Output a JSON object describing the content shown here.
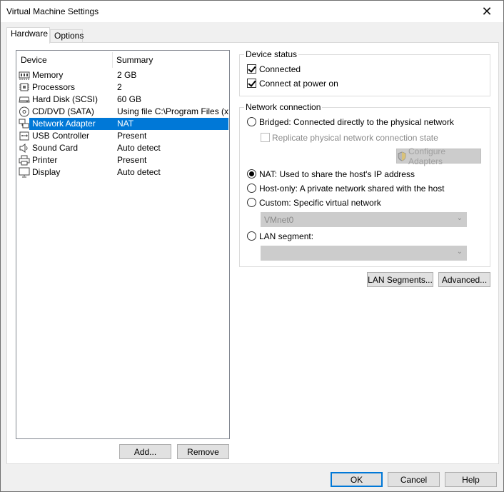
{
  "window": {
    "title": "Virtual Machine Settings",
    "close_glyph": "✕"
  },
  "tabs": [
    {
      "label": "Hardware",
      "active": true
    },
    {
      "label": "Options",
      "active": false
    }
  ],
  "device_list": {
    "headers": {
      "device": "Device",
      "summary": "Summary"
    },
    "rows": [
      {
        "icon": "memory-icon",
        "name": "Memory",
        "summary": "2 GB"
      },
      {
        "icon": "processor-icon",
        "name": "Processors",
        "summary": "2"
      },
      {
        "icon": "hard-disk-icon",
        "name": "Hard Disk (SCSI)",
        "summary": "60 GB"
      },
      {
        "icon": "cd-dvd-icon",
        "name": "CD/DVD (SATA)",
        "summary": "Using file C:\\Program Files (x..."
      },
      {
        "icon": "network-adapter-icon",
        "name": "Network Adapter",
        "summary": "NAT",
        "selected": true
      },
      {
        "icon": "usb-icon",
        "name": "USB Controller",
        "summary": "Present"
      },
      {
        "icon": "sound-card-icon",
        "name": "Sound Card",
        "summary": "Auto detect"
      },
      {
        "icon": "printer-icon",
        "name": "Printer",
        "summary": "Present"
      },
      {
        "icon": "display-icon",
        "name": "Display",
        "summary": "Auto detect"
      }
    ],
    "add_label": "Add...",
    "remove_label": "Remove"
  },
  "device_status": {
    "title": "Device status",
    "connected": {
      "label": "Connected",
      "checked": true
    },
    "connect_power_on": {
      "label": "Connect at power on",
      "checked": true
    }
  },
  "network_connection": {
    "title": "Network connection",
    "bridged": "Bridged: Connected directly to the physical network",
    "replicate": "Replicate physical network connection state",
    "configure_adapters": "Configure Adapters",
    "nat": "NAT: Used to share the host's IP address",
    "host_only": "Host-only: A private network shared with the host",
    "custom": "Custom: Specific virtual network",
    "custom_value": "VMnet0",
    "lan_segment": "LAN segment:",
    "lan_value": "",
    "selected": "nat"
  },
  "buttons": {
    "lan_segments": "LAN Segments...",
    "advanced": "Advanced...",
    "ok": "OK",
    "cancel": "Cancel",
    "help": "Help"
  },
  "colors": {
    "selection": "#0078d7",
    "button_border_default": "#0078d7"
  }
}
